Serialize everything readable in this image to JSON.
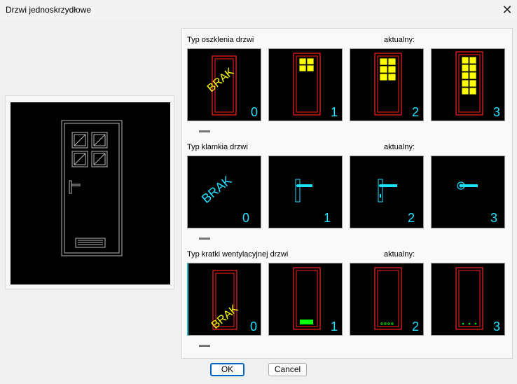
{
  "window": {
    "title": "Drzwi jednoskrzydłowe"
  },
  "sections": [
    {
      "label": "Typ oszklenia drzwi",
      "current_label": "aktualny:",
      "tiles": [
        {
          "number": "0",
          "text": "BRAK"
        },
        {
          "number": "1"
        },
        {
          "number": "2"
        },
        {
          "number": "3"
        }
      ]
    },
    {
      "label": "Typ klamkia drzwi",
      "current_label": "aktualny:",
      "tiles": [
        {
          "number": "0",
          "text": "BRAK"
        },
        {
          "number": "1"
        },
        {
          "number": "2"
        },
        {
          "number": "3"
        }
      ]
    },
    {
      "label": "Typ kratki wentylacyjnej drzwi",
      "current_label": "aktualny:",
      "tiles": [
        {
          "number": "0",
          "text": "BRAK"
        },
        {
          "number": "1"
        },
        {
          "number": "2"
        },
        {
          "number": "3"
        }
      ]
    }
  ],
  "buttons": {
    "ok": "OK",
    "cancel": "Cancel"
  },
  "colors": {
    "frame": "#ff2020",
    "glass": "#ffff00",
    "cyan": "#20e0ff",
    "green": "#00ff00"
  }
}
